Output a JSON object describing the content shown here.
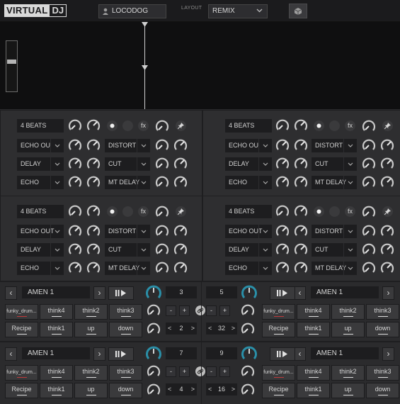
{
  "app": {
    "logo_main": "VIRTUAL",
    "logo_dj": "DJ"
  },
  "topbar": {
    "user": "LOCODOG",
    "layout_label": "LAYOUT",
    "layout_value": "REMIX"
  },
  "fx_panels": [
    {
      "beats": "4 BEATS",
      "slot1": "ECHO OU",
      "slot2": "DELAY",
      "slot3": "ECHO",
      "slot4": "DISTORT",
      "slot5": "CUT",
      "slot6": "MT DELAY",
      "fx_label": "fx"
    },
    {
      "beats": "4 BEATS",
      "slot1": "ECHO OU",
      "slot2": "DELAY",
      "slot3": "ECHO",
      "slot4": "DISTORT",
      "slot5": "CUT",
      "slot6": "MT DELAY",
      "fx_label": "fx"
    },
    {
      "beats": "4 BEATS",
      "slot1": "ECHO OUT",
      "slot2": "DELAY",
      "slot3": "ECHO",
      "slot4": "DISTORTI",
      "slot5": "CUT",
      "slot6": "MT DELAY",
      "fx_label": "fx"
    },
    {
      "beats": "4 BEATS",
      "slot1": "ECHO OUT",
      "slot2": "DELAY",
      "slot3": "ECHO",
      "slot4": "DISTORTI",
      "slot5": "CUT",
      "slot6": "MT DELAY",
      "fx_label": "fx"
    }
  ],
  "sampler_decks": [
    {
      "track": "AMEN 1",
      "number": "3",
      "step": "2",
      "pads": [
        "funky_drum...",
        "think4",
        "think2",
        "think3",
        "Recipe",
        "think1",
        "up",
        "down"
      ]
    },
    {
      "track": "AMEN 1",
      "number": "5",
      "step": "32",
      "pads": [
        "funky_drum...",
        "think4",
        "think2",
        "think3",
        "Recipe",
        "think1",
        "up",
        "down"
      ]
    },
    {
      "track": "AMEN 1",
      "number": "7",
      "step": "4",
      "pads": [
        "funky_drum...",
        "think4",
        "think2",
        "think3",
        "Recipe",
        "think1",
        "up",
        "down"
      ]
    },
    {
      "track": "AMEN 1",
      "number": "9",
      "step": "16",
      "pads": [
        "funky_drum...",
        "think4",
        "think2",
        "think3",
        "Recipe",
        "think1",
        "up",
        "down"
      ]
    }
  ],
  "symbols": {
    "prev": "‹",
    "next": "›",
    "minus": "-",
    "plus": "+",
    "dec": "<",
    "inc": ">"
  },
  "colors": {
    "accent_teal": "#2a8fa8",
    "pad_underline_red": "#c0383b",
    "background": "#2b2b2d"
  }
}
